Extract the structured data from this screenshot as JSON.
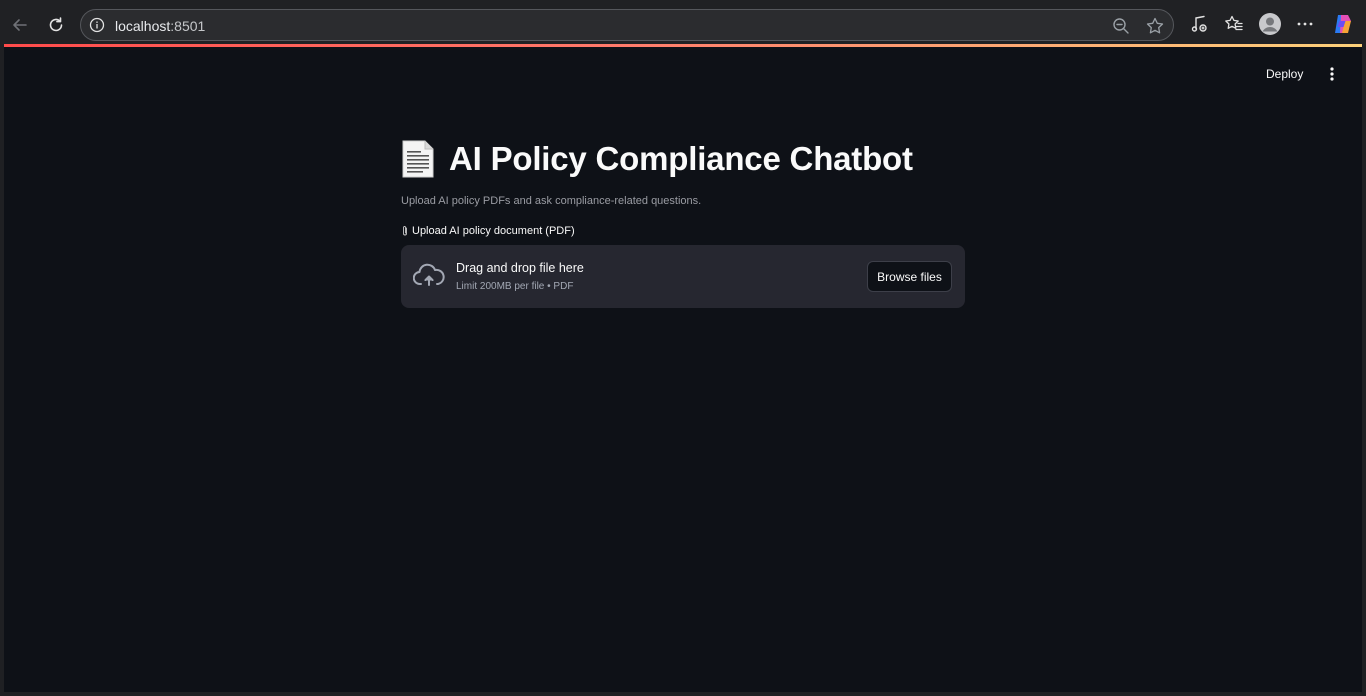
{
  "browser": {
    "url_host": "localhost",
    "url_port": ":8501"
  },
  "toolbar": {
    "deploy_label": "Deploy"
  },
  "main": {
    "title": "AI Policy Compliance Chatbot",
    "caption": "Upload AI policy PDFs and ask compliance-related questions.",
    "upload": {
      "label": "Upload AI policy document (PDF)",
      "drag_text": "Drag and drop file here",
      "limit_text": "Limit 200MB per file • PDF",
      "browse_label": "Browse files"
    }
  },
  "colors": {
    "app_background": "#0e1117",
    "dropzone_background": "#262730",
    "text_primary": "#fafafa",
    "text_muted": "#9a9ca3",
    "accent_gradient_start": "#ff4b4b",
    "accent_gradient_end": "#fdd17a"
  },
  "icons": [
    "back-icon",
    "reload-icon",
    "site-info-icon",
    "zoom-icon",
    "star-icon",
    "media-icon",
    "favorites-icon",
    "profile-icon",
    "more-icon",
    "copilot-icon",
    "kebab-menu-icon",
    "document-icon",
    "paperclip-icon",
    "cloud-upload-icon"
  ]
}
